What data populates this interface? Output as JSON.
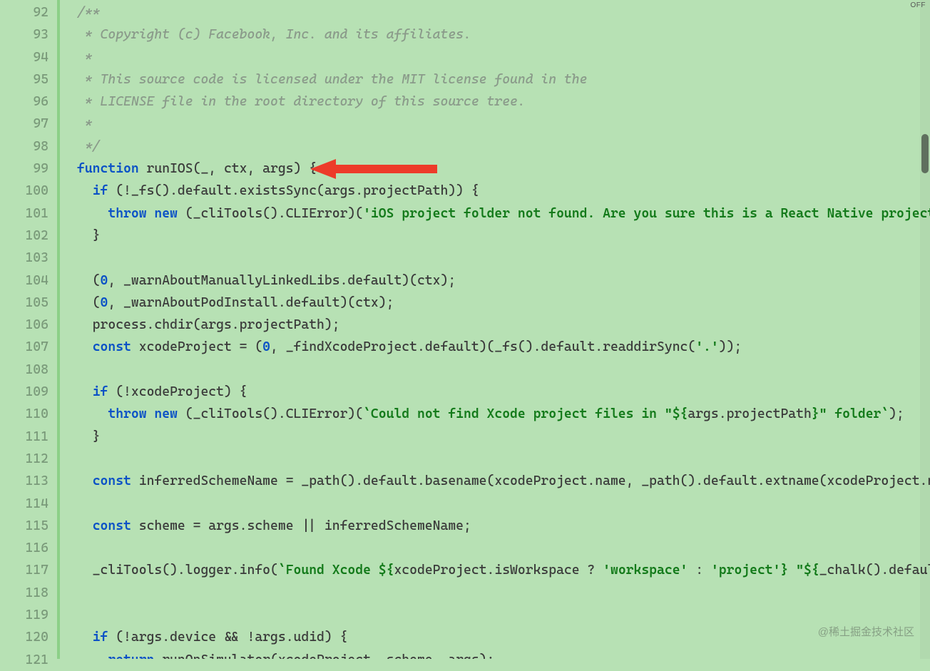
{
  "off_label": "OFF",
  "watermark": "@稀土掘金技术社区",
  "lines": [
    {
      "num": "92",
      "tokens": [
        {
          "t": "comment",
          "v": "/**"
        }
      ]
    },
    {
      "num": "93",
      "tokens": [
        {
          "t": "comment",
          "v": " * Copyright (c) Facebook, Inc. and its affiliates."
        }
      ]
    },
    {
      "num": "94",
      "tokens": [
        {
          "t": "comment",
          "v": " *"
        }
      ]
    },
    {
      "num": "95",
      "tokens": [
        {
          "t": "comment",
          "v": " * This source code is licensed under the MIT license found in the"
        }
      ]
    },
    {
      "num": "96",
      "tokens": [
        {
          "t": "comment",
          "v": " * LICENSE file in the root directory of this source tree."
        }
      ]
    },
    {
      "num": "97",
      "tokens": [
        {
          "t": "comment",
          "v": " *"
        }
      ]
    },
    {
      "num": "98",
      "tokens": [
        {
          "t": "comment",
          "v": " */"
        }
      ]
    },
    {
      "num": "99",
      "tokens": [
        {
          "t": "keyword",
          "v": "function"
        },
        {
          "t": "default",
          "v": " runIOS(_, ctx, args) {"
        }
      ]
    },
    {
      "num": "100",
      "tokens": [
        {
          "t": "default",
          "v": "  "
        },
        {
          "t": "keyword",
          "v": "if"
        },
        {
          "t": "default",
          "v": " (!_fs().default.existsSync(args.projectPath)) {"
        }
      ]
    },
    {
      "num": "101",
      "tokens": [
        {
          "t": "default",
          "v": "    "
        },
        {
          "t": "keyword",
          "v": "throw"
        },
        {
          "t": "default",
          "v": " "
        },
        {
          "t": "keyword",
          "v": "new"
        },
        {
          "t": "default",
          "v": " (_cliTools().CLIError)("
        },
        {
          "t": "string",
          "v": "'iOS project folder not found. Are you sure this is a React Native project?'"
        }
      ]
    },
    {
      "num": "102",
      "tokens": [
        {
          "t": "default",
          "v": "  }"
        }
      ]
    },
    {
      "num": "103",
      "tokens": [
        {
          "t": "default",
          "v": ""
        }
      ]
    },
    {
      "num": "104",
      "tokens": [
        {
          "t": "default",
          "v": "  ("
        },
        {
          "t": "number",
          "v": "0"
        },
        {
          "t": "default",
          "v": ", _warnAboutManuallyLinkedLibs.default)(ctx);"
        }
      ]
    },
    {
      "num": "105",
      "tokens": [
        {
          "t": "default",
          "v": "  ("
        },
        {
          "t": "number",
          "v": "0"
        },
        {
          "t": "default",
          "v": ", _warnAboutPodInstall.default)(ctx);"
        }
      ]
    },
    {
      "num": "106",
      "tokens": [
        {
          "t": "default",
          "v": "  process.chdir(args.projectPath);"
        }
      ]
    },
    {
      "num": "107",
      "tokens": [
        {
          "t": "default",
          "v": "  "
        },
        {
          "t": "const-kw",
          "v": "const"
        },
        {
          "t": "default",
          "v": " xcodeProject = ("
        },
        {
          "t": "number",
          "v": "0"
        },
        {
          "t": "default",
          "v": ", _findXcodeProject.default)(_fs().default.readdirSync("
        },
        {
          "t": "string",
          "v": "'.'"
        },
        {
          "t": "default",
          "v": "));"
        }
      ]
    },
    {
      "num": "108",
      "tokens": [
        {
          "t": "default",
          "v": ""
        }
      ]
    },
    {
      "num": "109",
      "tokens": [
        {
          "t": "default",
          "v": "  "
        },
        {
          "t": "keyword",
          "v": "if"
        },
        {
          "t": "default",
          "v": " (!xcodeProject) {"
        }
      ]
    },
    {
      "num": "110",
      "tokens": [
        {
          "t": "default",
          "v": "    "
        },
        {
          "t": "keyword",
          "v": "throw"
        },
        {
          "t": "default",
          "v": " "
        },
        {
          "t": "keyword",
          "v": "new"
        },
        {
          "t": "default",
          "v": " (_cliTools().CLIError)("
        },
        {
          "t": "string",
          "v": "`Could not find Xcode project files in \"${"
        },
        {
          "t": "default",
          "v": "args.projectPath"
        },
        {
          "t": "string",
          "v": "}\" folder`"
        },
        {
          "t": "default",
          "v": ");"
        }
      ]
    },
    {
      "num": "111",
      "tokens": [
        {
          "t": "default",
          "v": "  }"
        }
      ]
    },
    {
      "num": "112",
      "tokens": [
        {
          "t": "default",
          "v": ""
        }
      ]
    },
    {
      "num": "113",
      "tokens": [
        {
          "t": "default",
          "v": "  "
        },
        {
          "t": "const-kw",
          "v": "const"
        },
        {
          "t": "default",
          "v": " inferredSchemeName = _path().default.basename(xcodeProject.name, _path().default.extname(xcodeProject.nam"
        }
      ]
    },
    {
      "num": "114",
      "tokens": [
        {
          "t": "default",
          "v": ""
        }
      ]
    },
    {
      "num": "115",
      "tokens": [
        {
          "t": "default",
          "v": "  "
        },
        {
          "t": "const-kw",
          "v": "const"
        },
        {
          "t": "default",
          "v": " scheme = args.scheme || inferredSchemeName;"
        }
      ]
    },
    {
      "num": "116",
      "tokens": [
        {
          "t": "default",
          "v": ""
        }
      ]
    },
    {
      "num": "117",
      "tokens": [
        {
          "t": "default",
          "v": "  _cliTools().logger.info("
        },
        {
          "t": "string",
          "v": "`Found Xcode ${"
        },
        {
          "t": "default",
          "v": "xcodeProject.isWorkspace ? "
        },
        {
          "t": "string",
          "v": "'workspace'"
        },
        {
          "t": "default",
          "v": " : "
        },
        {
          "t": "string",
          "v": "'project'"
        },
        {
          "t": "string",
          "v": "}"
        },
        {
          "t": "string",
          "v": " \"${"
        },
        {
          "t": "default",
          "v": "_chalk().default."
        }
      ]
    },
    {
      "num": "118",
      "tokens": [
        {
          "t": "default",
          "v": ""
        }
      ]
    },
    {
      "num": "119",
      "tokens": [
        {
          "t": "default",
          "v": ""
        }
      ]
    },
    {
      "num": "120",
      "tokens": [
        {
          "t": "default",
          "v": "  "
        },
        {
          "t": "keyword",
          "v": "if"
        },
        {
          "t": "default",
          "v": " (!args.device && !args.udid) {"
        }
      ]
    },
    {
      "num": "121",
      "tokens": [
        {
          "t": "default",
          "v": "    "
        },
        {
          "t": "keyword",
          "v": "return"
        },
        {
          "t": "default",
          "v": " runOnSimulator(xcodeProject, scheme, args);"
        }
      ]
    }
  ]
}
